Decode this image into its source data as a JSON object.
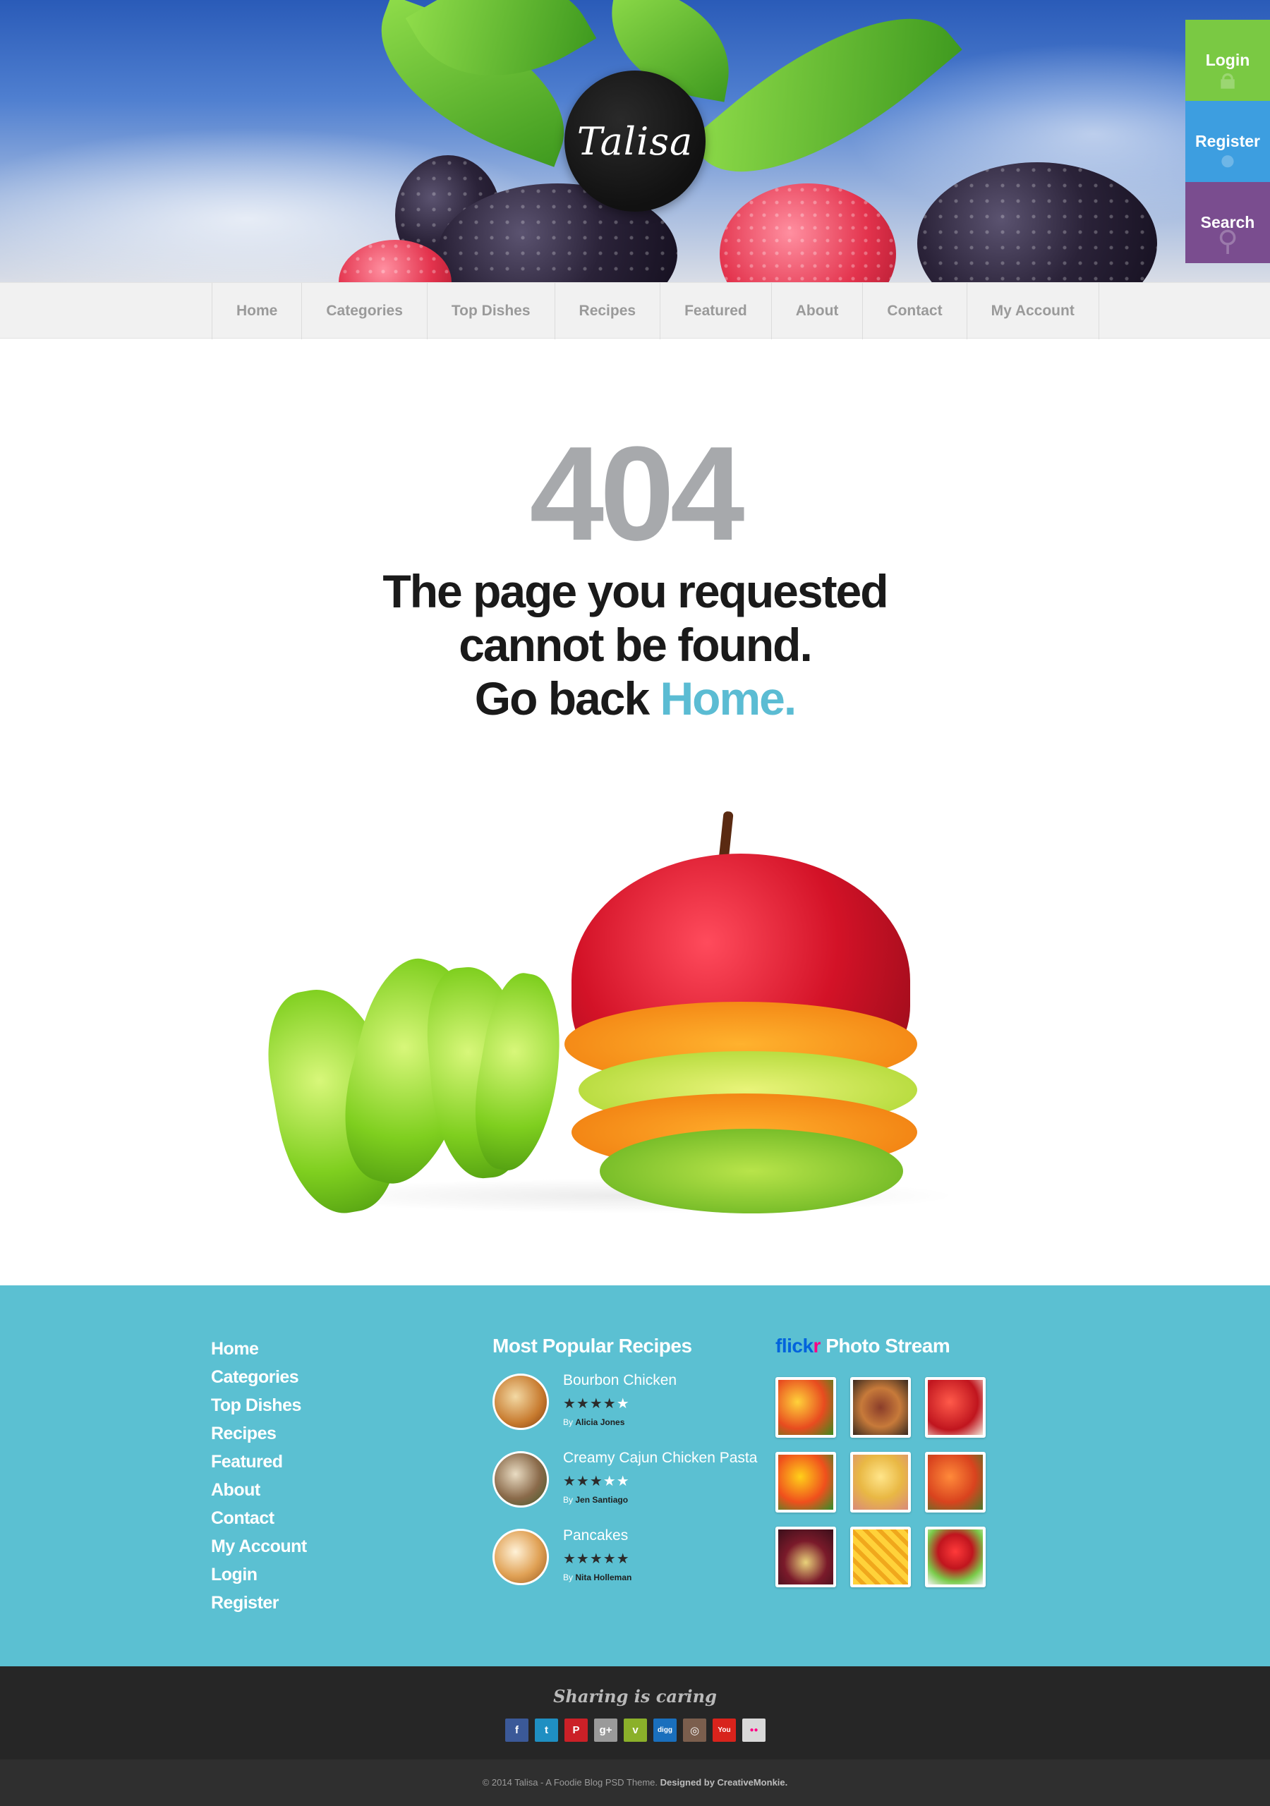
{
  "brand": {
    "logo_text": "Talisa"
  },
  "side_tabs": [
    {
      "label": "Login",
      "color": "#7ac943",
      "icon": "lock-icon"
    },
    {
      "label": "Register",
      "color": "#3d9ee0",
      "icon": "user-icon"
    },
    {
      "label": "Search",
      "color": "#7a4d8f",
      "icon": "search-icon"
    }
  ],
  "nav": {
    "items": [
      "Home",
      "Categories",
      "Top Dishes",
      "Recipes",
      "Featured",
      "About",
      "Contact",
      "My Account"
    ]
  },
  "error": {
    "code": "404",
    "line1": "The page you requested",
    "line2": "cannot be found.",
    "line3_prefix": "Go back ",
    "home_link": "Home."
  },
  "footer": {
    "links": [
      "Home",
      "Categories",
      "Top Dishes",
      "Recipes",
      "Featured",
      "About",
      "Contact",
      "My Account",
      "Login",
      "Register"
    ],
    "recipes_title": "Most Popular Recipes",
    "recipes": [
      {
        "name": "Bourbon Chicken",
        "rating": 4,
        "by_prefix": "By ",
        "author": "Alicia Jones"
      },
      {
        "name": "Creamy Cajun Chicken Pasta",
        "rating": 3,
        "by_prefix": "By ",
        "author": "Jen Santiago"
      },
      {
        "name": "Pancakes",
        "rating": 5,
        "by_prefix": "By ",
        "author": "Nita Holleman"
      }
    ],
    "flickr_brand_a": "flick",
    "flickr_brand_b": "r",
    "flickr_title": "Photo Stream"
  },
  "sharing": {
    "title": "Sharing is caring",
    "icons": [
      {
        "name": "facebook-icon",
        "glyph": "f",
        "color": "#3b5998"
      },
      {
        "name": "twitter-icon",
        "glyph": "t",
        "color": "#1f8fc2"
      },
      {
        "name": "pinterest-icon",
        "glyph": "P",
        "color": "#cb2027"
      },
      {
        "name": "google-plus-icon",
        "glyph": "g+",
        "color": "#9a9a9a"
      },
      {
        "name": "vimeo-icon",
        "glyph": "v",
        "color": "#8bb02a"
      },
      {
        "name": "digg-icon",
        "glyph": "digg",
        "color": "#1a6fbd"
      },
      {
        "name": "instagram-icon",
        "glyph": "◎",
        "color": "#7b5e4d"
      },
      {
        "name": "youtube-icon",
        "glyph": "You",
        "color": "#d8231c"
      },
      {
        "name": "flickr-icon",
        "glyph": "●●",
        "color": "#d9d9d9"
      }
    ]
  },
  "copyright": {
    "text": "© 2014 Talisa - A Foodie Blog PSD Theme. ",
    "credit": "Designed by CreativeMonkie."
  }
}
